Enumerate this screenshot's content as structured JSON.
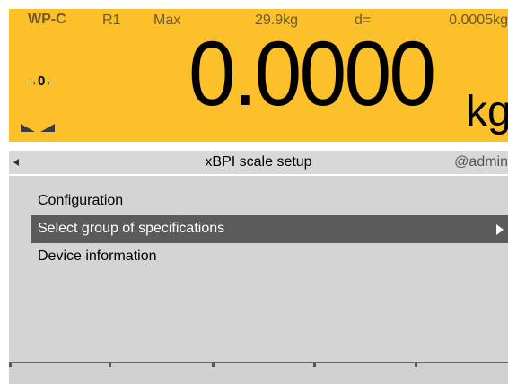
{
  "weighing": {
    "model": "WP-C",
    "range": "R1",
    "max_label": "Max",
    "max_value": "29.9kg",
    "d_label": "d=",
    "d_value": "0.0005kg",
    "zero_indicator": "→0←",
    "weight": "0.0000",
    "unit": "kg",
    "background_color": "#fcc02b"
  },
  "header": {
    "back_icon": "left-triangle-icon",
    "title": "xBPI scale setup",
    "user": "@admin"
  },
  "menu": {
    "items": [
      {
        "label": "Configuration",
        "selected": false
      },
      {
        "label": "Select group of specifications",
        "selected": true,
        "icon": "right-triangle-icon"
      },
      {
        "label": "Device information",
        "selected": false
      }
    ]
  },
  "colors": {
    "selected_bg": "#5b5b5b",
    "menu_bg": "#d4d4d4"
  }
}
